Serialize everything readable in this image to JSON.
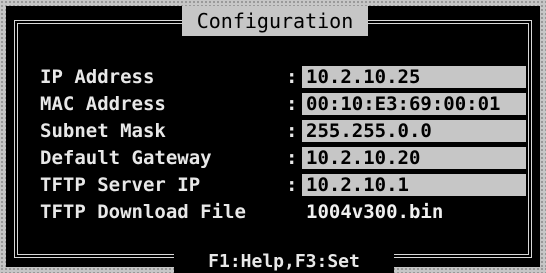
{
  "window": {
    "title": "Configuration"
  },
  "footer": {
    "hint": "F1:Help,F3:Set"
  },
  "fields": [
    {
      "label": "IP Address",
      "value": "10.2.10.25"
    },
    {
      "label": "MAC Address",
      "value": "00:10:E3:69:00:01"
    },
    {
      "label": "Subnet Mask",
      "value": "255.255.0.0"
    },
    {
      "label": "Default Gateway",
      "value": "10.2.10.20"
    },
    {
      "label": "TFTP Server IP",
      "value": "10.2.10.1"
    },
    {
      "label": "TFTP Download File",
      "value": "1004v300.bin",
      "selected": true
    }
  ],
  "separator": ":",
  "colors": {
    "background": "#000000",
    "field_background": "#c6c6c6",
    "text": "#e8e8e8"
  }
}
